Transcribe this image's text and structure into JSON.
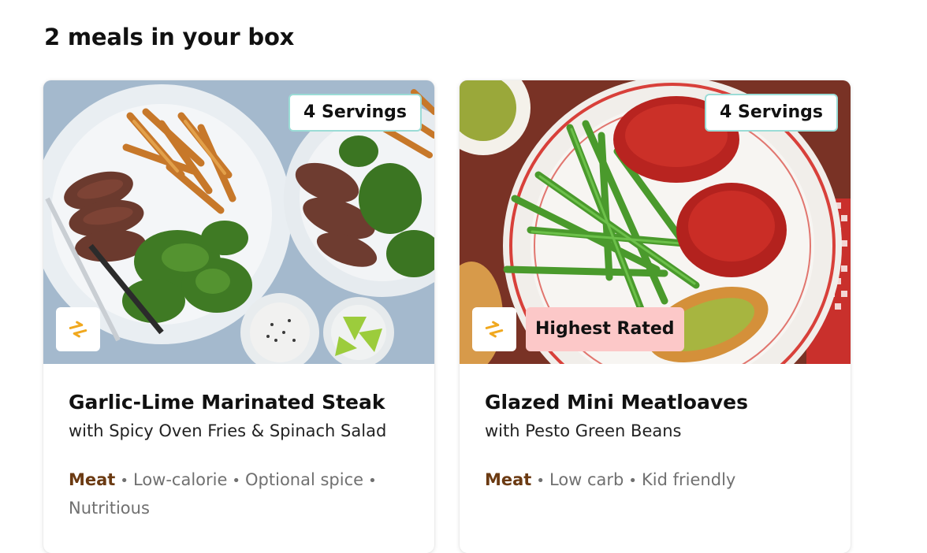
{
  "page": {
    "title": "2 meals in your box"
  },
  "meals": [
    {
      "servings": "4 Servings",
      "badge": "",
      "title": "Garlic-Lime Marinated Steak",
      "subtitle": "with Spicy Oven Fries & Spinach Salad",
      "primary_tag": "Meat",
      "tags": [
        "Low-calorie",
        "Optional spice",
        "Nutritious"
      ],
      "swap_icon": "swap-arrows-icon"
    },
    {
      "servings": "4 Servings",
      "badge": "Highest Rated",
      "title": "Glazed Mini Meatloaves",
      "subtitle": "with Pesto Green Beans",
      "primary_tag": "Meat",
      "tags": [
        "Low carb",
        "Kid friendly"
      ],
      "swap_icon": "swap-arrows-icon"
    }
  ],
  "colors": {
    "servings_border": "#9bdcd6",
    "rated_badge_bg": "#fcc8c8",
    "primary_tag": "#6b3a12",
    "swap_icon": "#f0a81e"
  }
}
